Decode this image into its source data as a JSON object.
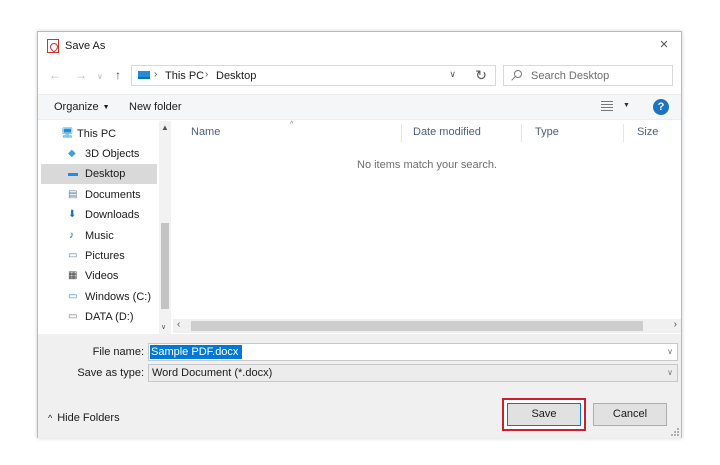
{
  "window": {
    "title": "Save As",
    "close": "×"
  },
  "navigation": {
    "back": "←",
    "forward": "→",
    "recent": "∨",
    "up": "↑",
    "breadcrumb": [
      "This PC",
      "Desktop"
    ],
    "breadcrumb_sep": "›",
    "address_dropdown": "∨",
    "refresh": "↻",
    "search_placeholder": "Search Desktop"
  },
  "toolbar": {
    "organize_label": "Organize",
    "organize_caret": "▼",
    "new_folder_label": "New folder",
    "view_caret": "▼",
    "help": "?"
  },
  "sidebar": {
    "items": [
      {
        "label": "This PC",
        "icon": "pc-icon",
        "glyph": "🖥",
        "color": "#1e8fe0"
      },
      {
        "label": "3D Objects",
        "icon": "cube-icon",
        "glyph": "◆",
        "color": "#3aa0e8"
      },
      {
        "label": "Desktop",
        "icon": "desktop-icon",
        "glyph": "▬",
        "color": "#1e8fe0",
        "selected": true
      },
      {
        "label": "Documents",
        "icon": "document-icon",
        "glyph": "▤",
        "color": "#5b7fa6"
      },
      {
        "label": "Downloads",
        "icon": "download-icon",
        "glyph": "⬇",
        "color": "#1e73be"
      },
      {
        "label": "Music",
        "icon": "music-icon",
        "glyph": "♪",
        "color": "#2f5f8f"
      },
      {
        "label": "Pictures",
        "icon": "pictures-icon",
        "glyph": "▭",
        "color": "#5b7fa6"
      },
      {
        "label": "Videos",
        "icon": "video-icon",
        "glyph": "▦",
        "color": "#444444"
      },
      {
        "label": "Windows (C:)",
        "icon": "drive-icon",
        "glyph": "▭",
        "color": "#1e8fe0"
      },
      {
        "label": "DATA (D:)",
        "icon": "drive-icon",
        "glyph": "▭",
        "color": "#777777"
      }
    ],
    "scroll_up": "▲",
    "scroll_down": "∨"
  },
  "file_list": {
    "columns": [
      "Name",
      "Date modified",
      "Type",
      "Size"
    ],
    "sort_arrow": "^",
    "empty_message": "No items match your search."
  },
  "hscroll": {
    "left": "‹",
    "right": "›"
  },
  "form": {
    "file_name_label": "File name:",
    "file_name_value": "Sample PDF.docx",
    "save_type_label": "Save as type:",
    "save_type_value": "Word Document (*.docx)",
    "dropdown_arrow": "∨"
  },
  "footer": {
    "hide_folders_label": "Hide Folders",
    "hide_folders_chevron": "^",
    "save_label": "Save",
    "cancel_label": "Cancel"
  },
  "colors": {
    "selection_highlight": "#0078d7",
    "annotation_box": "#cc1f2b",
    "help_blue": "#1e73be"
  }
}
